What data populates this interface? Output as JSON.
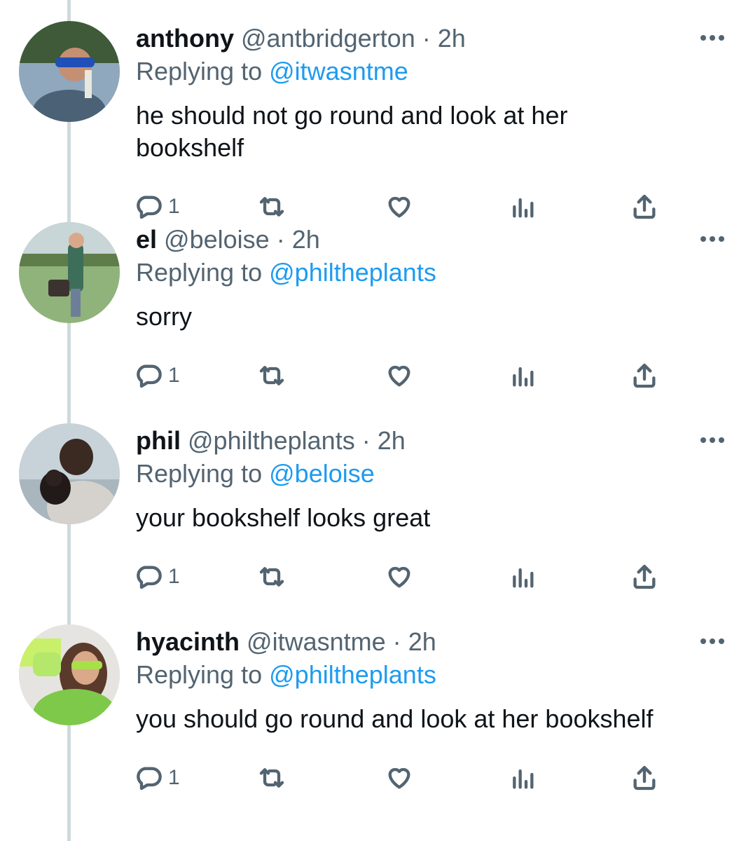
{
  "tweets": [
    {
      "display_name": "el",
      "handle": "@beloise",
      "separator": "·",
      "time": "2h",
      "replying_prefix": "Replying to",
      "replying_to": "@philtheplants",
      "text": "sorry",
      "reply_count": "1"
    },
    {
      "display_name": "phil",
      "handle": "@philtheplants",
      "separator": "·",
      "time": "2h",
      "replying_prefix": "Replying to",
      "replying_to": "@beloise",
      "text": "your bookshelf looks great",
      "reply_count": "1"
    },
    {
      "display_name": "hyacinth",
      "handle": "@itwasntme",
      "separator": "·",
      "time": "2h",
      "replying_prefix": "Replying to",
      "replying_to": "@philtheplants",
      "text": "you should go round and look at her bookshelf",
      "reply_count": "1"
    },
    {
      "display_name": "anthony",
      "handle": "@antbridgerton",
      "separator": "·",
      "time": "2h",
      "replying_prefix": "Replying to",
      "replying_to": "@itwasntme",
      "text": "he should not go round and look at her bookshelf",
      "reply_count": "1"
    }
  ],
  "icons": {
    "reply": "reply-icon",
    "retweet": "retweet-icon",
    "like": "heart-icon",
    "views": "views-icon",
    "share": "share-icon",
    "more": "more-icon"
  },
  "colors": {
    "link": "#1d9bf0",
    "secondary_text": "#536471",
    "thread_line": "#cfd9de"
  }
}
